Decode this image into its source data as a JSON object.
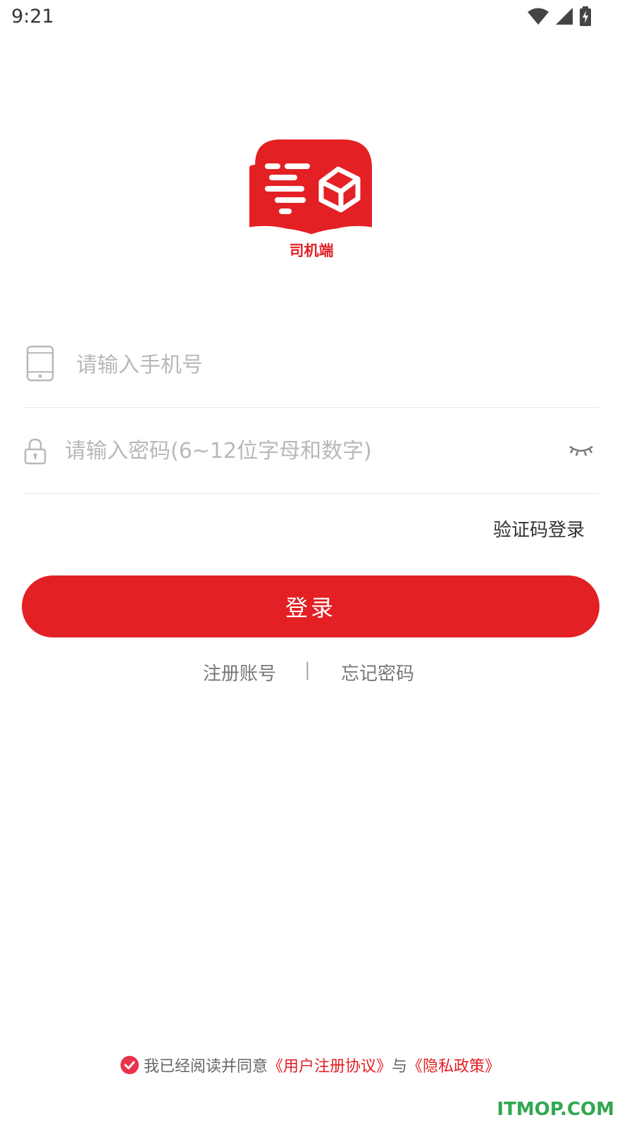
{
  "status_bar": {
    "time": "9:21"
  },
  "app": {
    "logo_caption": "司机端",
    "brand_color": "#e32024"
  },
  "form": {
    "phone_placeholder": "请输入手机号",
    "password_placeholder": "请输入密码(6~12位字母和数字)"
  },
  "sms_login_label": "验证码登录",
  "login_button_label": "登录",
  "links": {
    "register": "注册账号",
    "separator": "|",
    "forgot": "忘记密码"
  },
  "agreement": {
    "prefix": "我已经阅读并同意",
    "user_agreement": "《用户注册协议》",
    "joiner": "与",
    "privacy_policy": "《隐私政策》",
    "checked": true
  },
  "watermark": "ITMOP.COM",
  "icons": [
    "wifi-icon",
    "signal-icon",
    "battery-charging-icon",
    "phone-icon",
    "lock-icon",
    "eye-closed-icon",
    "check-circle-icon"
  ]
}
